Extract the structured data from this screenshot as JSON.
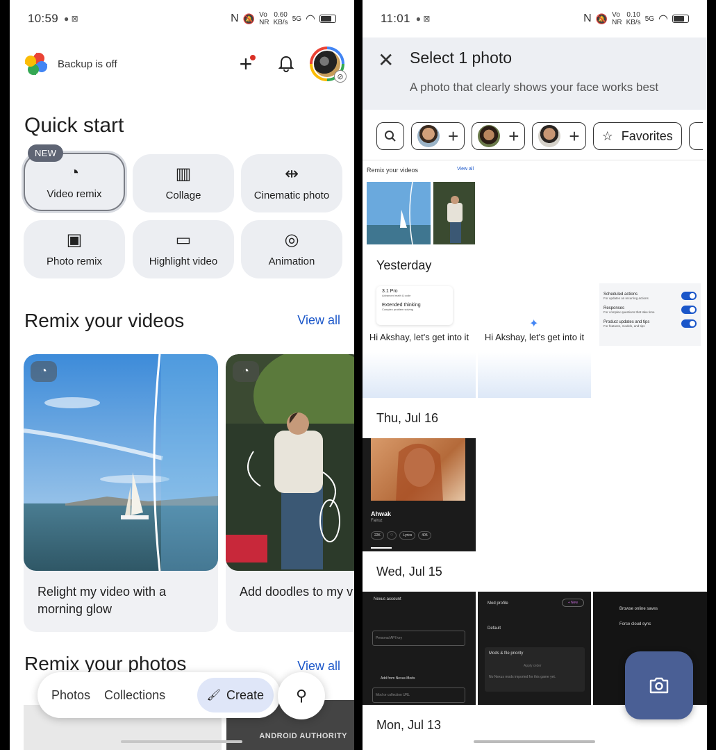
{
  "left": {
    "status": {
      "time": "10:59",
      "net": "0.60",
      "net_unit": "KB/s",
      "signal": "5G"
    },
    "backup_text": "Backup is off",
    "quick_start_title": "Quick start",
    "new_badge": "NEW",
    "chips": [
      "Video remix",
      "Collage",
      "Cinematic photo",
      "Photo remix",
      "Highlight video",
      "Animation"
    ],
    "remix_videos_title": "Remix your videos",
    "remix_photos_title": "Remix your photos",
    "view_all": "View all",
    "cards": [
      {
        "caption": "Relight my video with a morning glow"
      },
      {
        "caption": "Add doodles to my v"
      }
    ],
    "nav": {
      "photos": "Photos",
      "collections": "Collections",
      "create": "Create"
    },
    "watermark": "ANDROID AUTHORITY"
  },
  "right": {
    "status": {
      "time": "11:01",
      "net": "0.10",
      "net_unit": "KB/s",
      "signal": "5G"
    },
    "title": "Select 1 photo",
    "subtitle": "A photo that clearly shows your face works best",
    "favorites": "Favorites",
    "mini_heading": "Remix your videos",
    "mini_view_all": "View all",
    "dates": [
      "Yesterday",
      "Thu, Jul 16",
      "Wed, Jul 15",
      "Mon, Jul 13"
    ],
    "gemini_greeting": "Hi Akshay, let's get into it",
    "gemini_menu": {
      "model": "3.1 Pro",
      "model_sub": "Advanced math & code",
      "mode": "Extended thinking",
      "mode_sub": "Complex problem solving"
    },
    "settings_items": [
      {
        "title": "Scheduled actions",
        "sub": "For updates on recurring actions"
      },
      {
        "title": "Responses",
        "sub": "For complex questions that take time"
      },
      {
        "title": "Product updates and tips",
        "sub": "For features, models, and tips"
      }
    ],
    "song": {
      "title": "Ahwak",
      "artist": "Fairuz",
      "likes": "22K",
      "lyrics": "Lyrics",
      "comments": "405"
    },
    "nexus": {
      "account": "Nexus account",
      "api_key": "Personal API key",
      "add_mods": "Add from Nexus Mods",
      "mod_url": "Mod or collection URL",
      "mod_profile": "Mod profile",
      "new": "+ New",
      "default": "Default",
      "mods_priority": "Mods & file priority",
      "apply": "Apply order",
      "none": "No Nexus mods imported for this game yet."
    },
    "saves": {
      "browse": "Browse online saves",
      "force": "Force cloud sync"
    }
  }
}
